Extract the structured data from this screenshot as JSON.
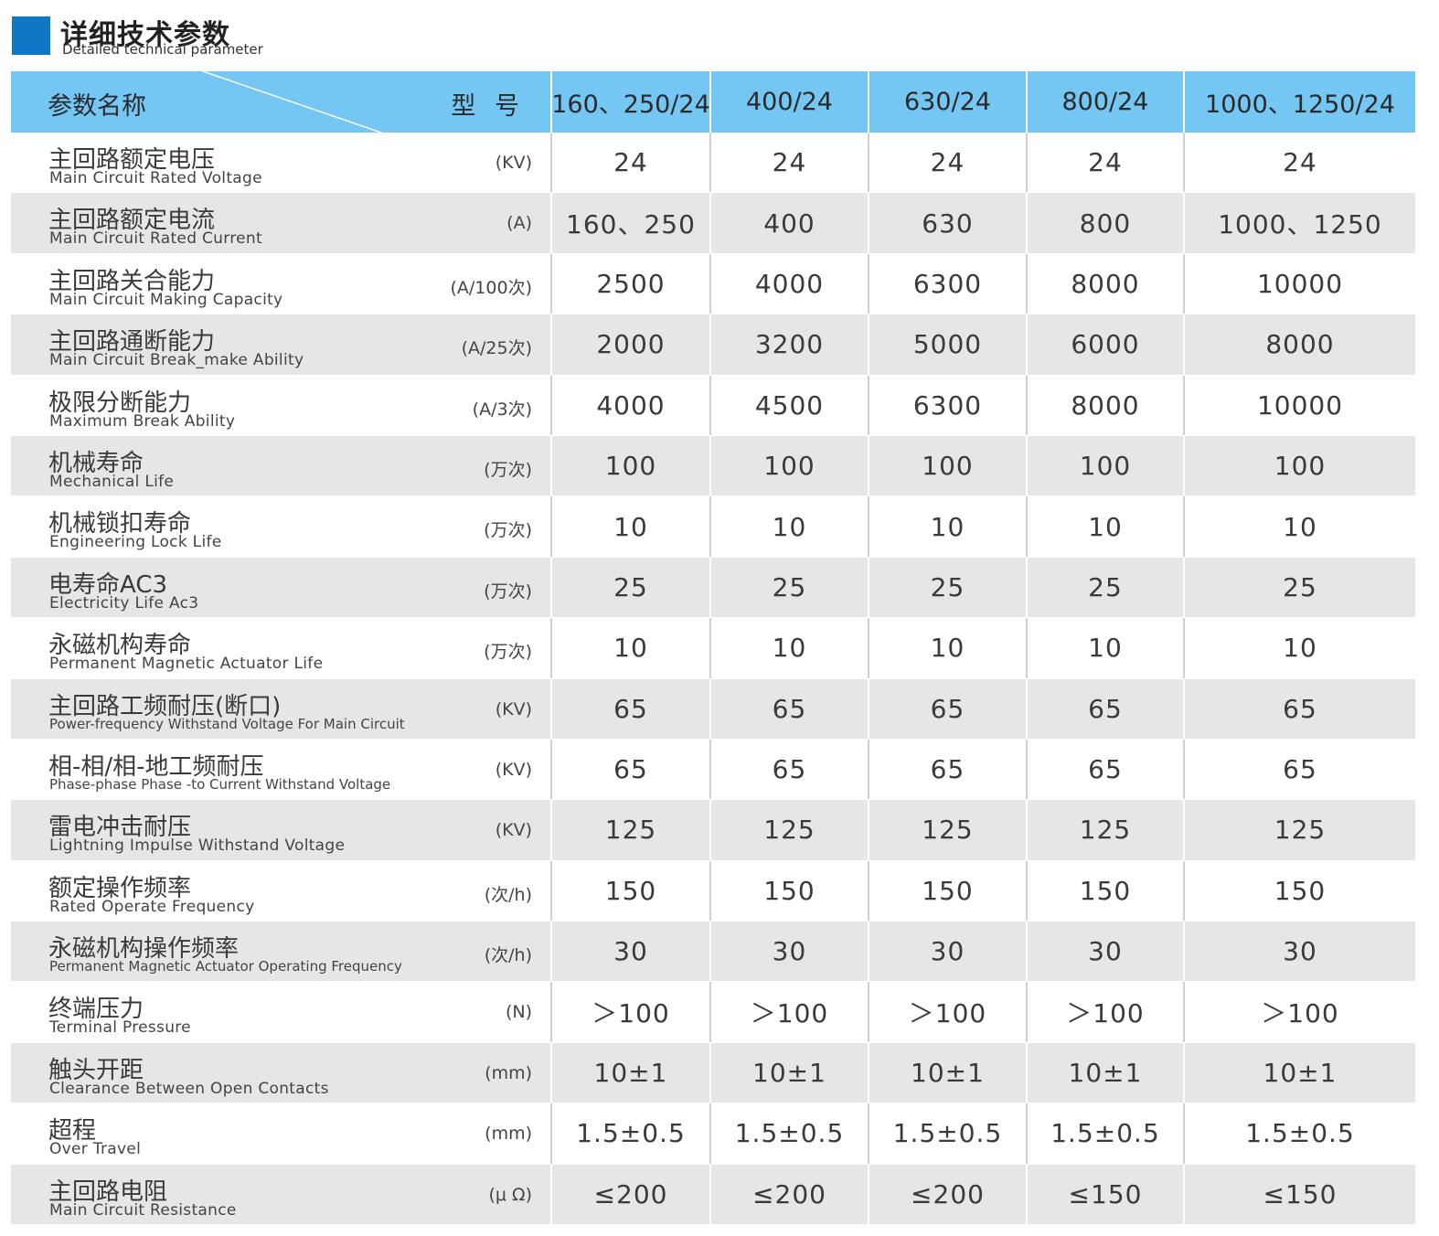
{
  "title": {
    "cn": "详细技术参数",
    "en": "Detailed technical parameter"
  },
  "colors": {
    "accent": "#0f77c5",
    "header_bg": "#74c6f3",
    "alt_row_bg": "#e6e6e6"
  },
  "header": {
    "param_label": "参数名称",
    "model_label": "型 号",
    "models": [
      "160、250/24",
      "400/24",
      "630/24",
      "800/24",
      "1000、1250/24"
    ]
  },
  "rows": [
    {
      "cn": "主回路额定电压",
      "en": "Main Circuit Rated Voltage",
      "unit": "(KV)",
      "values": [
        "24",
        "24",
        "24",
        "24",
        "24"
      ]
    },
    {
      "cn": "主回路额定电流",
      "en": "Main Circuit Rated Current",
      "unit": "(A)",
      "values": [
        "160、250",
        "400",
        "630",
        "800",
        "1000、1250"
      ]
    },
    {
      "cn": "主回路关合能力",
      "en": "Main Circuit Making Capacity",
      "unit": "(A/100次)",
      "values": [
        "2500",
        "4000",
        "6300",
        "8000",
        "10000"
      ]
    },
    {
      "cn": "主回路通断能力",
      "en": "Main Circuit Break_make  Ability",
      "unit": "(A/25次)",
      "values": [
        "2000",
        "3200",
        "5000",
        "6000",
        "8000"
      ]
    },
    {
      "cn": "极限分断能力",
      "en": "Maximum Break Ability",
      "unit": "(A/3次)",
      "values": [
        "4000",
        "4500",
        "6300",
        "8000",
        "10000"
      ]
    },
    {
      "cn": "机械寿命",
      "en": "Mechanical Life",
      "unit": "(万次)",
      "values": [
        "100",
        "100",
        "100",
        "100",
        "100"
      ]
    },
    {
      "cn": "机械锁扣寿命",
      "en": "Engineering Lock Life",
      "unit": "(万次)",
      "values": [
        "10",
        "10",
        "10",
        "10",
        "10"
      ]
    },
    {
      "cn": "电寿命AC3",
      "en": "Electricity Life Ac3",
      "unit": "(万次)",
      "values": [
        "25",
        "25",
        "25",
        "25",
        "25"
      ]
    },
    {
      "cn": "永磁机构寿命",
      "en": "Permanent Magnetic Actuator Life",
      "unit": "(万次)",
      "values": [
        "10",
        "10",
        "10",
        "10",
        "10"
      ]
    },
    {
      "cn": "主回路工频耐压(断口)",
      "en": "Power-frequency Withstand Voltage For Main Circuit",
      "unit": "(KV)",
      "values": [
        "65",
        "65",
        "65",
        "65",
        "65"
      ]
    },
    {
      "cn": "相-相/相-地工频耐压",
      "en": "Phase-phase  Phase -to Current Withstand Voltage",
      "unit": "(KV)",
      "values": [
        "65",
        "65",
        "65",
        "65",
        "65"
      ]
    },
    {
      "cn": "雷电冲击耐压",
      "en": "Lightning Impulse Withstand Voltage",
      "unit": "(KV)",
      "values": [
        "125",
        "125",
        "125",
        "125",
        "125"
      ]
    },
    {
      "cn": "额定操作频率",
      "en": "Rated Operate Frequency",
      "unit": "(次/h)",
      "values": [
        "150",
        "150",
        "150",
        "150",
        "150"
      ]
    },
    {
      "cn": "永磁机构操作频率",
      "en": "Permanent Magnetic Actuator Operating Frequency",
      "unit": "(次/h)",
      "values": [
        "30",
        "30",
        "30",
        "30",
        "30"
      ]
    },
    {
      "cn": "终端压力",
      "en": "Terminal Pressure",
      "unit": "(N)",
      "values": [
        "＞100",
        "＞100",
        "＞100",
        "＞100",
        "＞100"
      ]
    },
    {
      "cn": "触头开距",
      "en": "Clearance Between Open Contacts",
      "unit": "(mm)",
      "values": [
        "10±1",
        "10±1",
        "10±1",
        "10±1",
        "10±1"
      ]
    },
    {
      "cn": "超程",
      "en": "Over Travel",
      "unit": "(mm)",
      "values": [
        "1.5±0.5",
        "1.5±0.5",
        "1.5±0.5",
        "1.5±0.5",
        "1.5±0.5"
      ]
    },
    {
      "cn": "主回路电阻",
      "en": "Main Circuit Resistance",
      "unit": "(μ Ω)",
      "values": [
        "≤200",
        "≤200",
        "≤200",
        "≤150",
        "≤150"
      ]
    }
  ]
}
